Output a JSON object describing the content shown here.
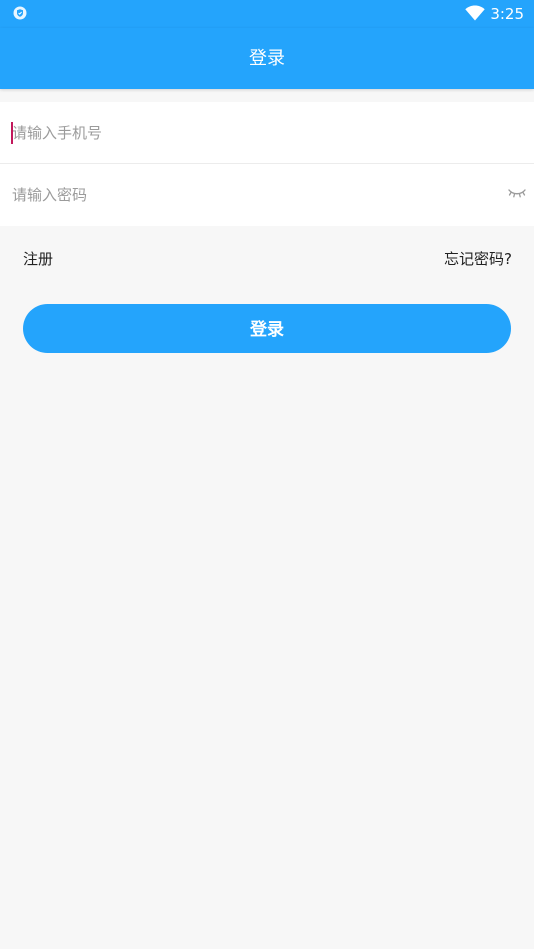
{
  "status_bar": {
    "time": "3:25",
    "left_icon": "shield-icon",
    "right_icon": "wifi-icon"
  },
  "app_bar": {
    "title": "登录",
    "background": "#24a4fc"
  },
  "form": {
    "phone_placeholder": "请输入手机号",
    "password_placeholder": "请输入密码",
    "password_toggle_icon": "eye-closed-icon"
  },
  "links": {
    "register": "注册",
    "forgot_password": "忘记密码?"
  },
  "login_button": {
    "label": "登录",
    "color": "#24a4fc"
  }
}
